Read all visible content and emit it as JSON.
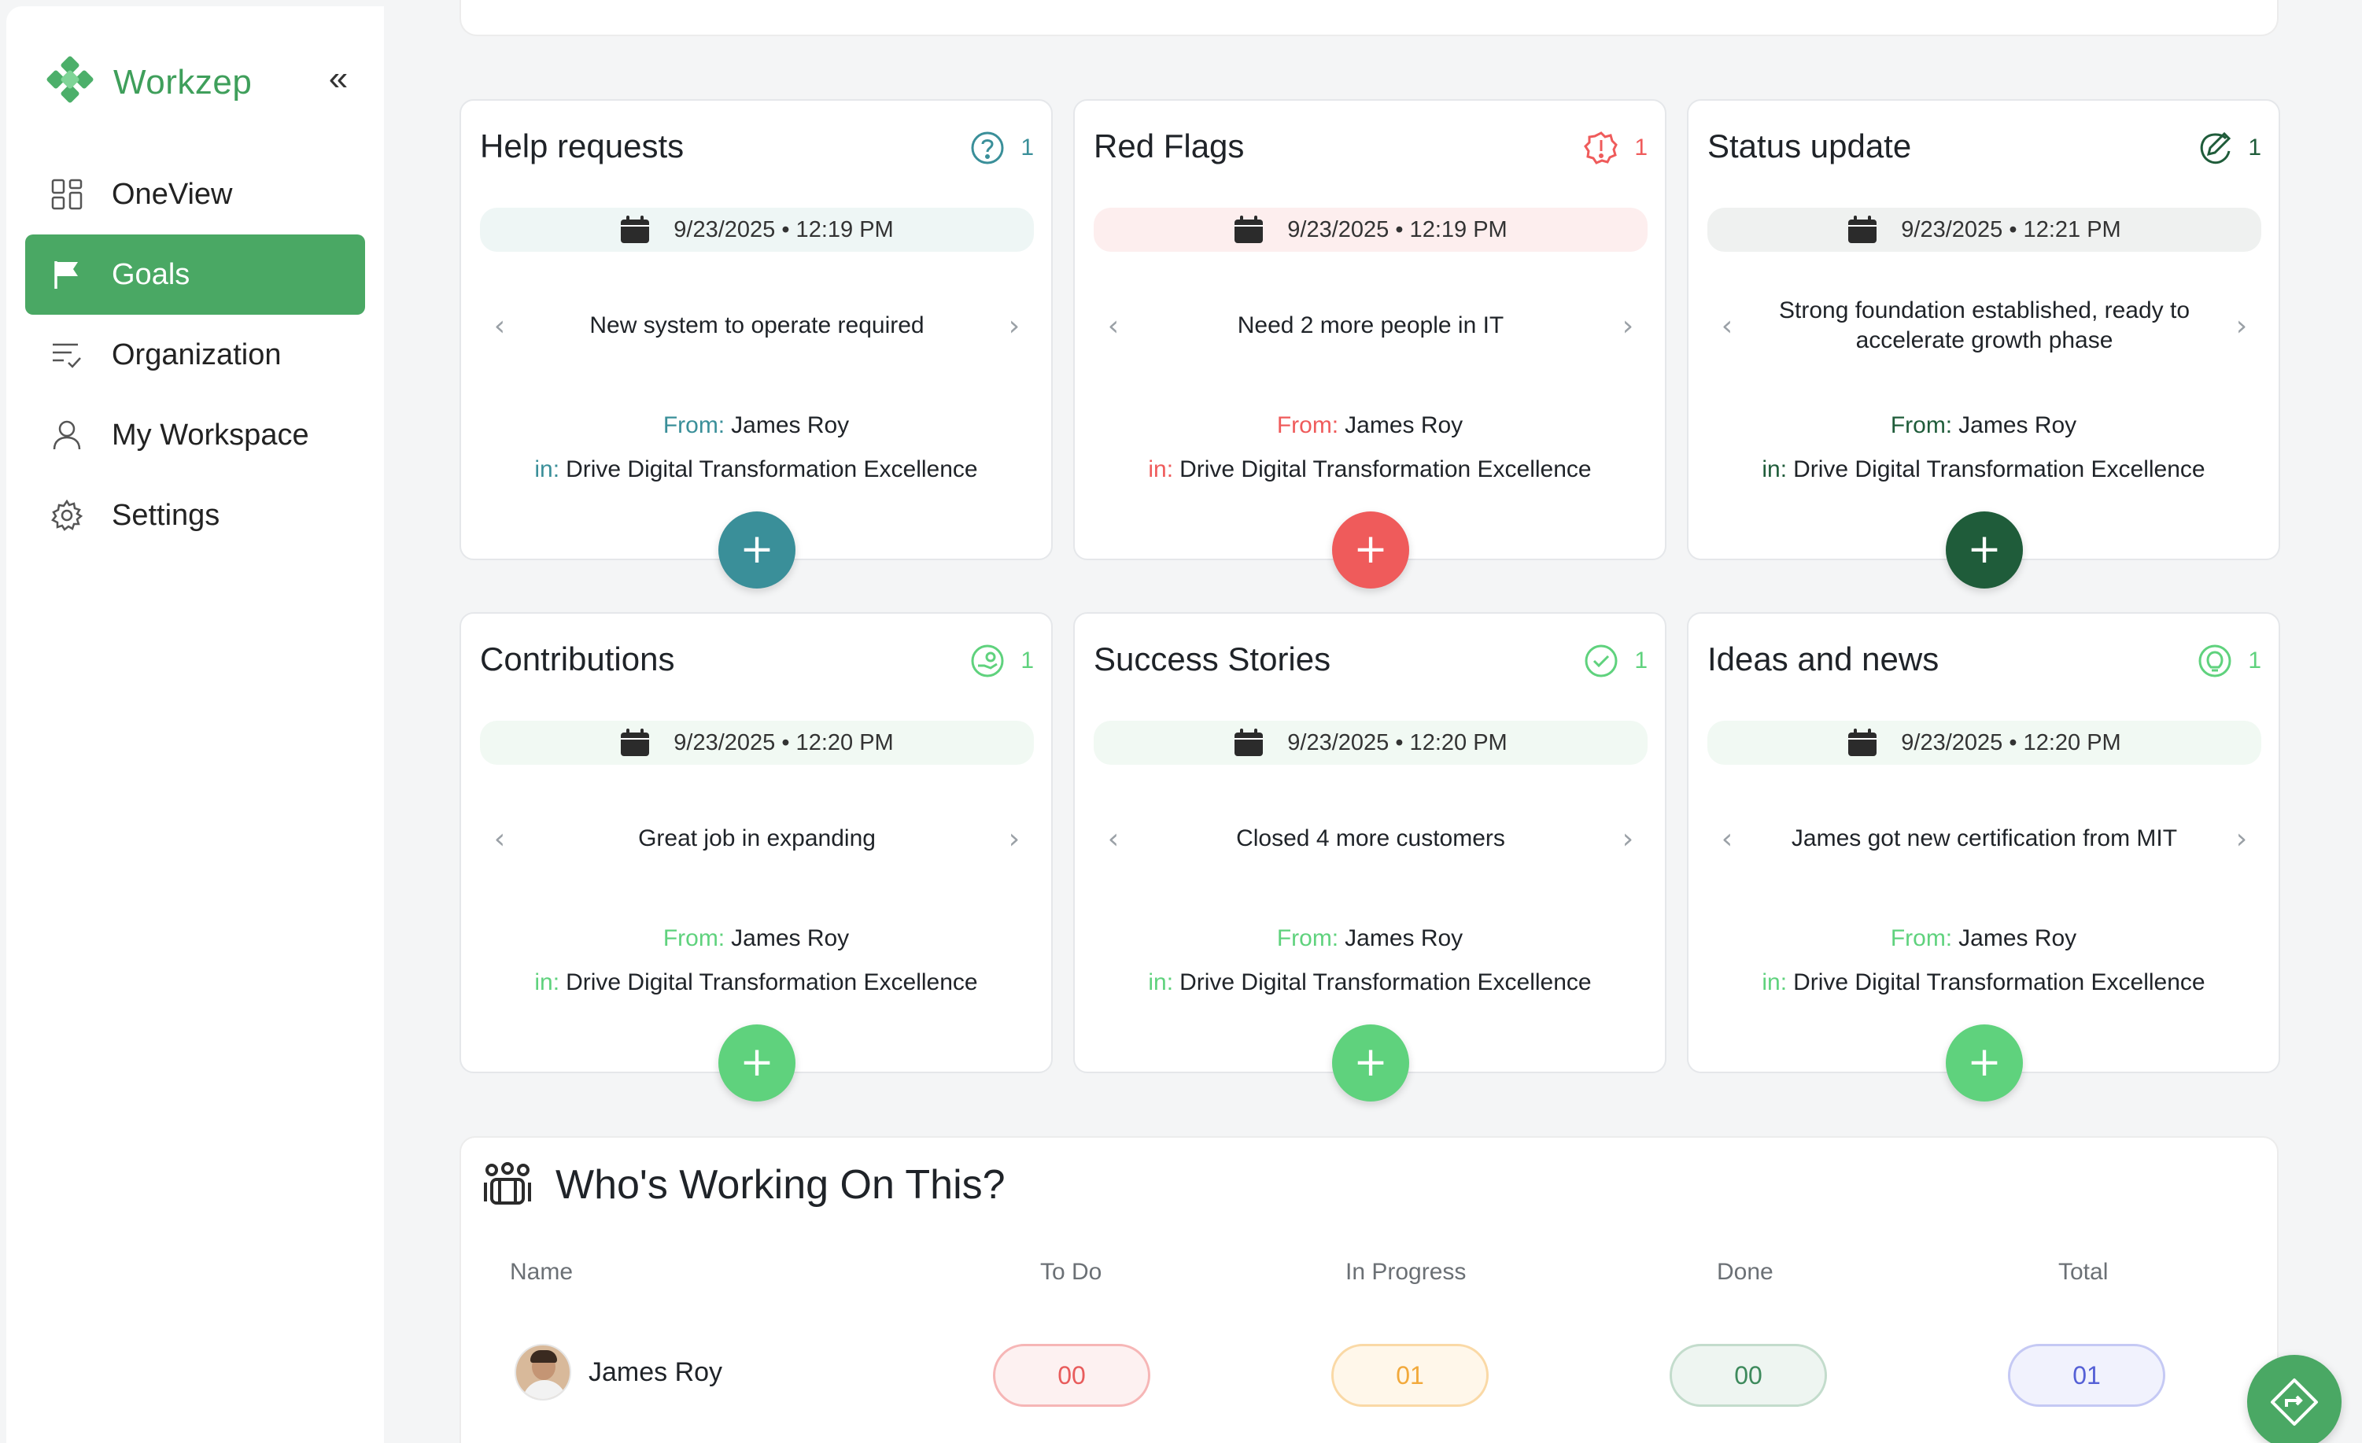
{
  "brand": {
    "name": "Workzep",
    "color": "#4aa864"
  },
  "sidebar": {
    "collapse_label": "«",
    "items": [
      {
        "label": "OneView",
        "icon": "grid-icon",
        "active": false
      },
      {
        "label": "Goals",
        "icon": "flag-icon",
        "active": true
      },
      {
        "label": "Organization",
        "icon": "list-check-icon",
        "active": false
      },
      {
        "label": "My Workspace",
        "icon": "user-icon",
        "active": false
      },
      {
        "label": "Settings",
        "icon": "gear-icon",
        "active": false
      }
    ]
  },
  "cards": [
    {
      "title": "Help requests",
      "count": "1",
      "icon": "question-icon",
      "accent": "#3a8f99",
      "pill_bg": "#eef6f5",
      "date": "9/23/2025 • 12:19 PM",
      "message": "New system to operate required",
      "from_label": "From:",
      "from": "James Roy",
      "in_label": "in:",
      "in": "Drive Digital Transformation Excellence",
      "button": "+"
    },
    {
      "title": "Red Flags",
      "count": "1",
      "icon": "alert-icon",
      "accent": "#ef5b5b",
      "pill_bg": "#fdeeee",
      "date": "9/23/2025 • 12:19 PM",
      "message": "Need 2 more people in IT",
      "from_label": "From:",
      "from": "James Roy",
      "in_label": "in:",
      "in": "Drive Digital Transformation Excellence",
      "button": "+"
    },
    {
      "title": "Status update",
      "count": "1",
      "icon": "edit-check-icon",
      "accent": "#1f5c3a",
      "pill_bg": "#eff1f0",
      "date": "9/23/2025 • 12:21 PM",
      "message": "Strong foundation established, ready to accelerate growth phase",
      "from_label": "From:",
      "from": "James Roy",
      "in_label": "in:",
      "in": "Drive Digital Transformation Excellence",
      "button": "+"
    },
    {
      "title": "Contributions",
      "count": "1",
      "icon": "hand-coin-icon",
      "accent": "#5fd27d",
      "pill_bg": "#f1f9f3",
      "date": "9/23/2025 • 12:20 PM",
      "message": "Great job in expanding",
      "from_label": "From:",
      "from": "James Roy",
      "in_label": "in:",
      "in": "Drive Digital Transformation Excellence",
      "button": "+"
    },
    {
      "title": "Success Stories",
      "count": "1",
      "icon": "check-circle-icon",
      "accent": "#5fd27d",
      "pill_bg": "#f1f9f3",
      "date": "9/23/2025 • 12:20 PM",
      "message": "Closed 4 more customers",
      "from_label": "From:",
      "from": "James Roy",
      "in_label": "in:",
      "in": "Drive Digital Transformation Excellence",
      "button": "+"
    },
    {
      "title": "Ideas and news",
      "count": "1",
      "icon": "lightbulb-icon",
      "accent": "#5fd27d",
      "pill_bg": "#f1f9f3",
      "date": "9/23/2025 • 12:20 PM",
      "message": "James got new certification from MIT",
      "from_label": "From:",
      "from": "James Roy",
      "in_label": "in:",
      "in": "Drive Digital Transformation Excellence",
      "button": "+"
    }
  ],
  "team": {
    "title": "Who's Working On This?",
    "icon": "team-icon",
    "headers": {
      "name": "Name",
      "todo": "To Do",
      "in_progress": "In Progress",
      "done": "Done",
      "total": "Total"
    },
    "rows": [
      {
        "name": "James Roy",
        "todo": "00",
        "in_progress": "01",
        "done": "00",
        "total": "01"
      }
    ],
    "colors": {
      "todo": "#e85c5c",
      "in_progress": "#f2a93b",
      "done": "#3d8a5c",
      "total": "#5560d6"
    }
  },
  "fab": {
    "icon": "diamond-directions-icon"
  }
}
